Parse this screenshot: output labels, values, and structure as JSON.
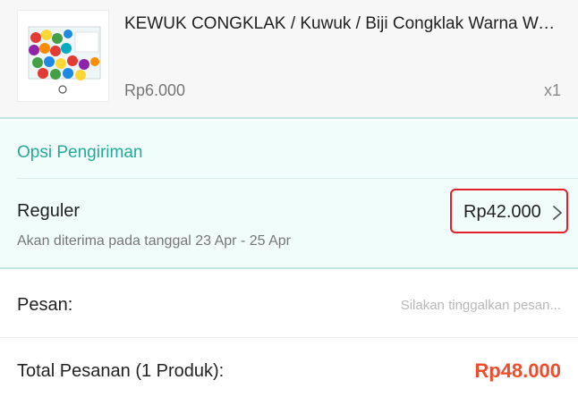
{
  "product": {
    "title": "KEWUK CONGKLAK / Kuwuk / Biji Congklak Warna Warni",
    "price": "Rp6.000",
    "quantity": "x1",
    "image_icon": "product-thumbnail-image"
  },
  "shipping": {
    "heading": "Opsi Pengiriman",
    "method": "Reguler",
    "eta": "Akan diterima pada tanggal 23 Apr - 25 Apr",
    "price": "Rp42.000",
    "chevron_icon": "chevron-right-icon",
    "highlight_color": "#e0202a"
  },
  "message": {
    "label": "Pesan:",
    "placeholder": "Silakan tinggalkan pesan...",
    "value": ""
  },
  "total": {
    "label": "Total Pesanan (1 Produk):",
    "value": "Rp48.000"
  },
  "colors": {
    "accent": "#26aa99",
    "price": "#ee4d2d"
  }
}
